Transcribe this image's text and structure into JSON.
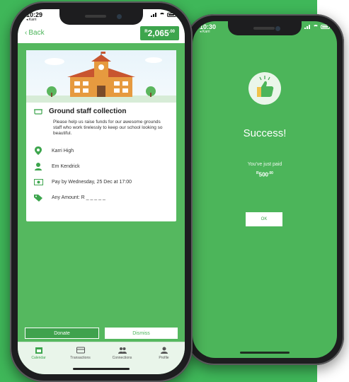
{
  "colors": {
    "brand_green": "#3da54d",
    "screen_green": "#4cb55a",
    "background_green": "#3fb759"
  },
  "front": {
    "status": {
      "time": "10:29",
      "carrier": "◂ Karri"
    },
    "header": {
      "back_label": "Back",
      "balance_prefix": "R",
      "balance_value": "2,065",
      "balance_cents": ".00"
    },
    "card": {
      "title": "Ground staff collection",
      "description": "Please help us raise funds for our awesome grounds staff who work tirelessly to keep our school looking so beautiful.",
      "school": "Karri High",
      "organiser": "Em Kendrick",
      "due": "Pay by Wednesday, 25 Dec at 17:00",
      "amount": "Any Amount: R _ _ _ _ _",
      "icons": [
        "basket-icon",
        "location-pin-icon",
        "person-icon",
        "cash-icon",
        "tag-icon"
      ]
    },
    "buttons": {
      "donate": "Donate",
      "dismiss": "Dismiss"
    },
    "tabs": [
      {
        "label": "Calendar",
        "icon": "calendar-icon",
        "active": true
      },
      {
        "label": "Transactions",
        "icon": "card-icon",
        "active": false
      },
      {
        "label": "Connections",
        "icon": "group-icon",
        "active": false
      },
      {
        "label": "Profile",
        "icon": "profile-icon",
        "active": false
      }
    ]
  },
  "back": {
    "status": {
      "time": "10:30",
      "carrier": "◂ Karri"
    },
    "title": "Success!",
    "message": "You've just paid",
    "amount_prefix": "R",
    "amount_value": "500",
    "amount_cents": ".00",
    "ok_label": "OK",
    "icon": "thumbs-up-icon"
  }
}
